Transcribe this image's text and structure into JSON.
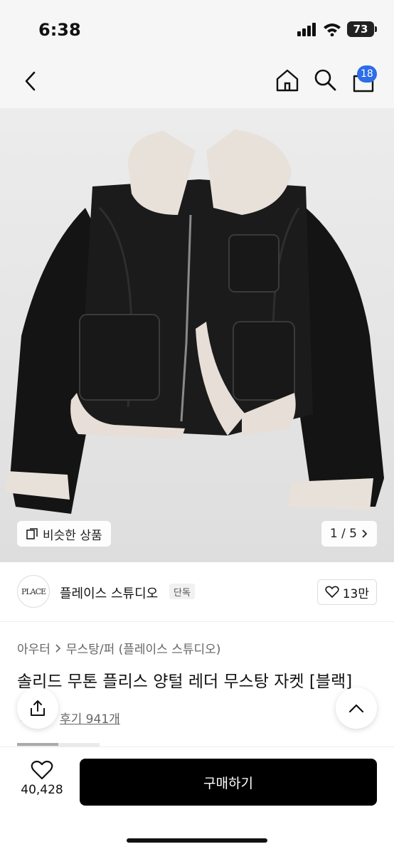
{
  "status": {
    "time": "6:38",
    "battery": "73"
  },
  "nav": {
    "badge_count": "18"
  },
  "gallery": {
    "similar_label": "비슷한 상품",
    "page_indicator": "1 / 5"
  },
  "brand": {
    "logo_text": "PLACE",
    "name": "플레이스 스튜디오",
    "tag": "단독",
    "likes": "13만"
  },
  "breadcrumb": {
    "category": "아우터",
    "sub": "무스탕/퍼 (플레이스 스튜디오)"
  },
  "product": {
    "title": "솔리드 무톤 플리스 양털 레더 무스탕 자켓 [블랙]",
    "reviews": "후기 941개"
  },
  "bottom": {
    "wish_count": "40,428",
    "buy_label": "구매하기"
  },
  "colors": {
    "accent": "#2c6de8",
    "buy_bg": "#000000"
  }
}
